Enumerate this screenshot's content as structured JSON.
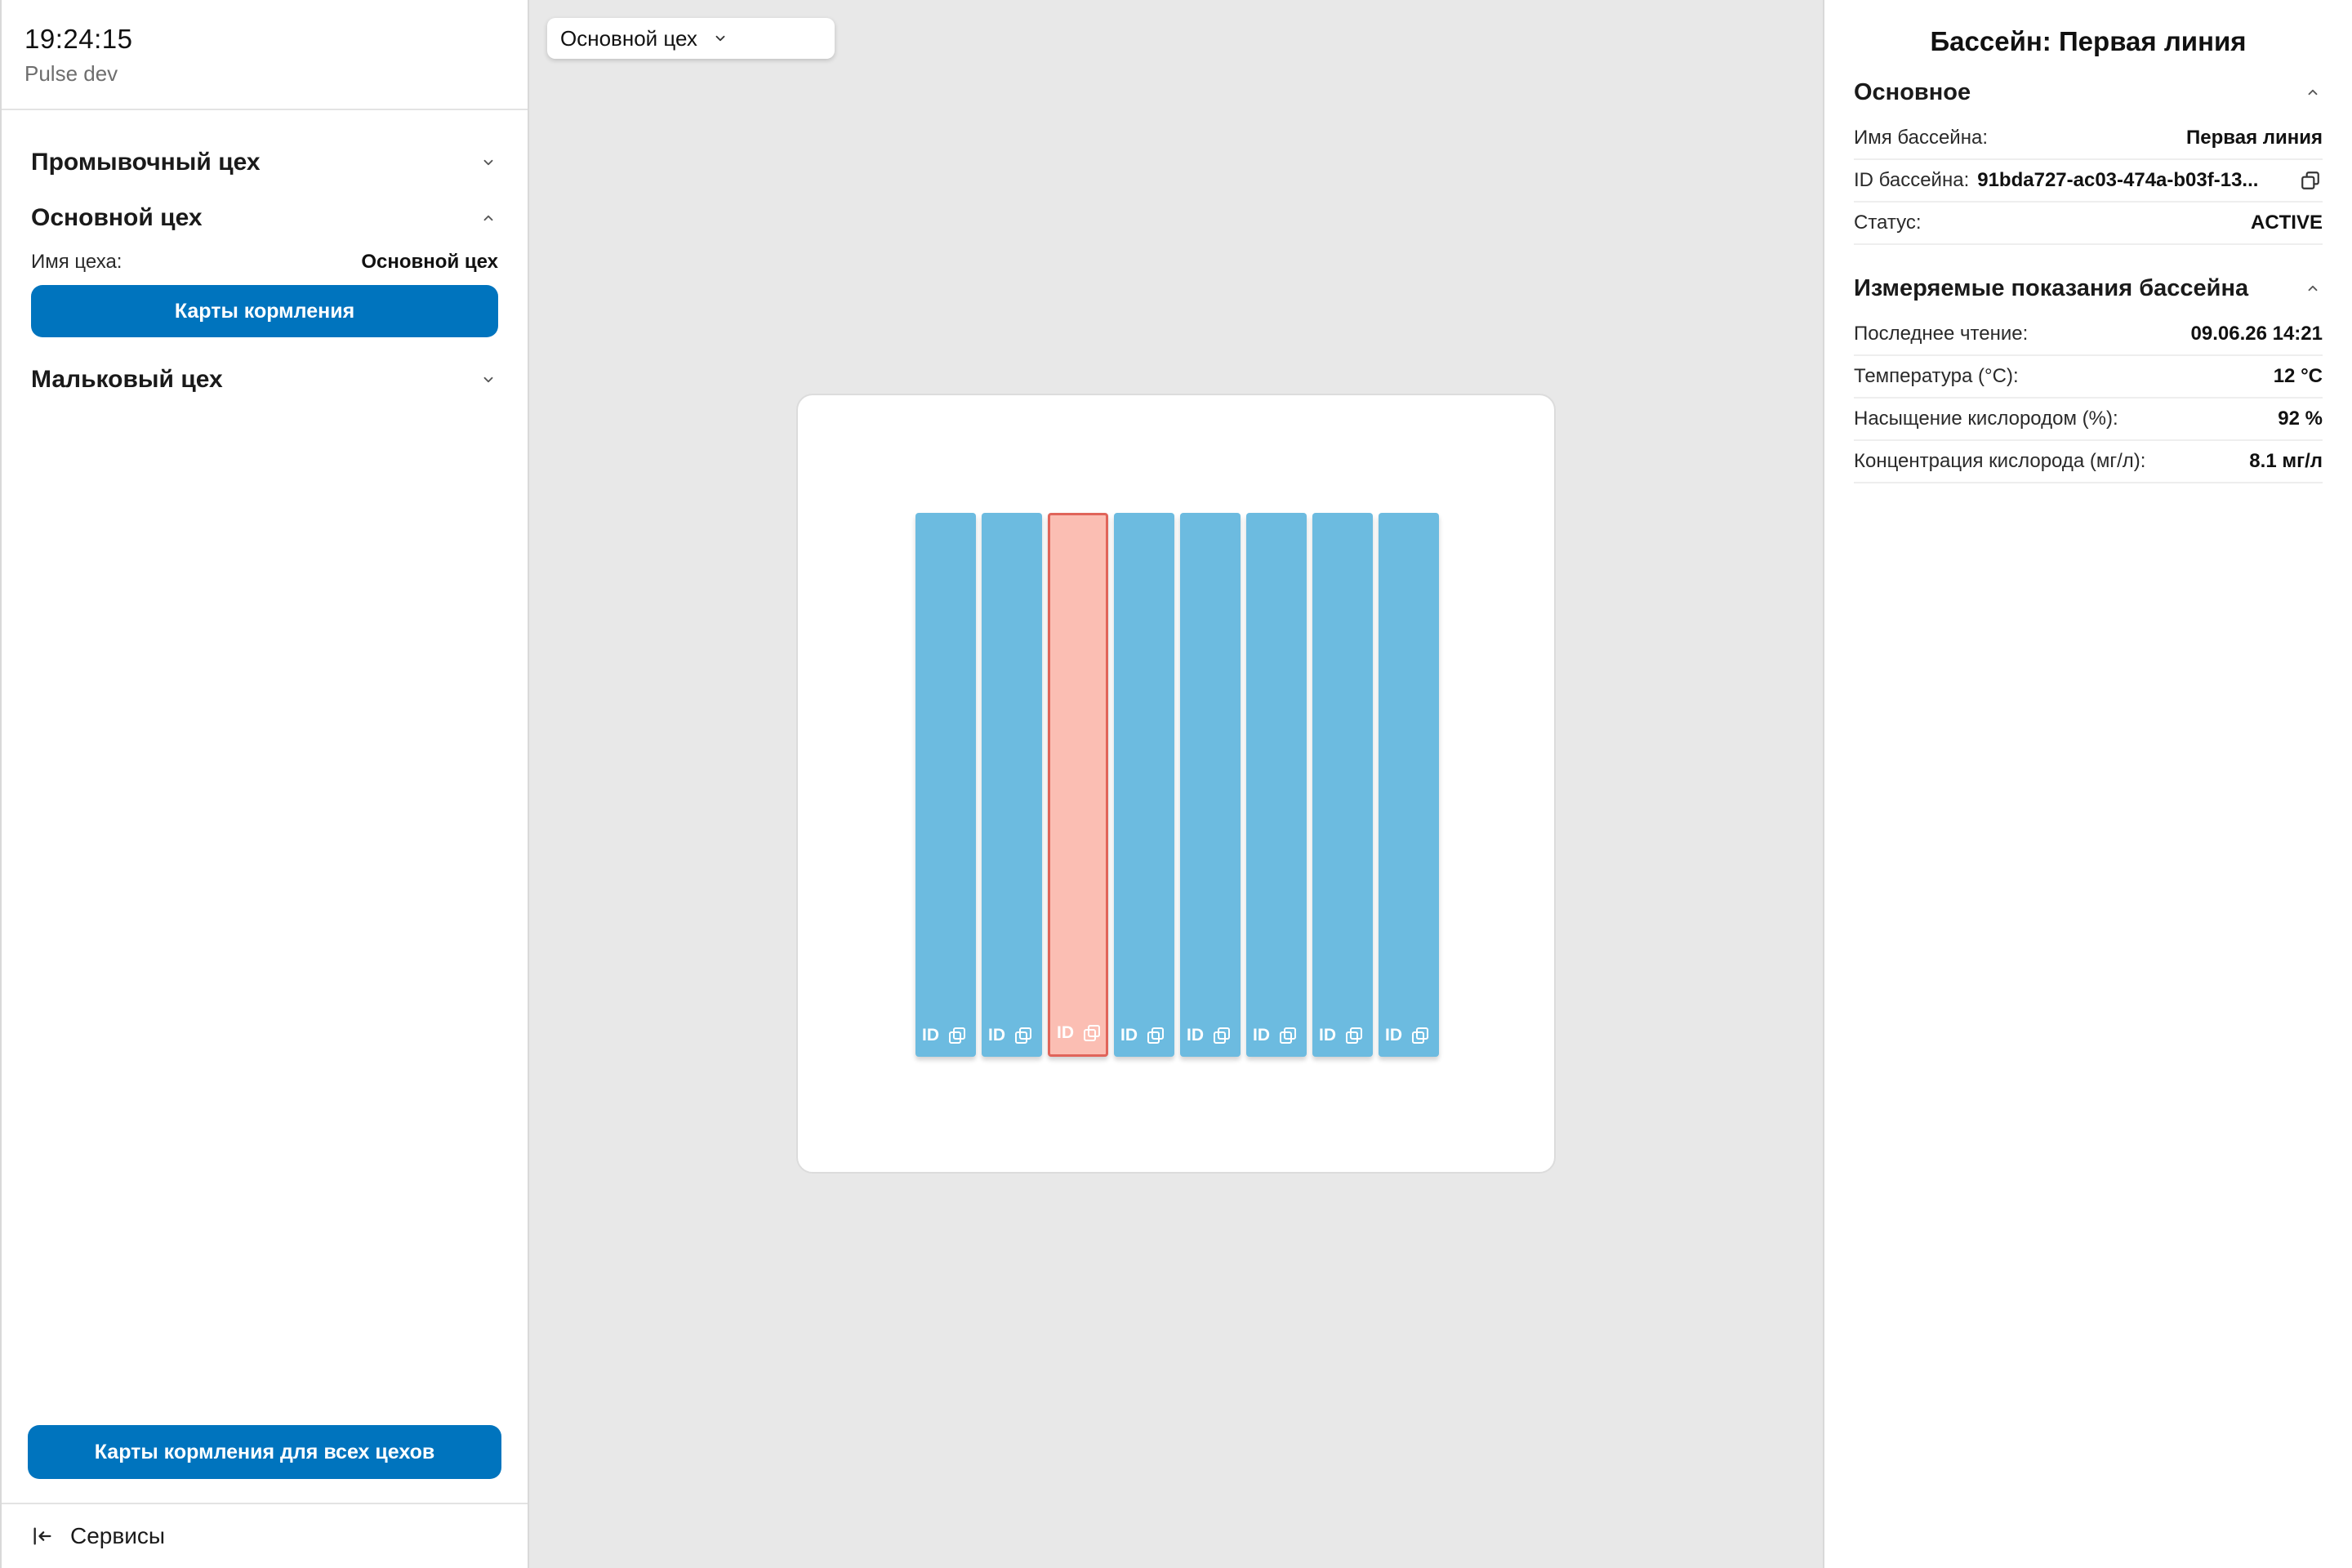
{
  "header": {
    "clock": "19:24:15",
    "environment": "Pulse dev"
  },
  "sidebar": {
    "sections": [
      {
        "title": "Промывочный цех",
        "expanded": false
      },
      {
        "title": "Основной цех",
        "expanded": true,
        "details": {
          "name_label": "Имя цеха:",
          "name_value": "Основной цех",
          "button_label": "Карты кормления"
        }
      },
      {
        "title": "Мальковый цех",
        "expanded": false
      }
    ],
    "all_feed_button": "Карты кормления для всех цехов",
    "footer_label": "Сервисы"
  },
  "canvas": {
    "workshop_selector": "Основной цех",
    "pools": [
      {
        "id_label": "ID",
        "selected": false
      },
      {
        "id_label": "ID",
        "selected": false
      },
      {
        "id_label": "ID",
        "selected": true
      },
      {
        "id_label": "ID",
        "selected": false
      },
      {
        "id_label": "ID",
        "selected": false
      },
      {
        "id_label": "ID",
        "selected": false
      },
      {
        "id_label": "ID",
        "selected": false
      },
      {
        "id_label": "ID",
        "selected": false
      }
    ],
    "colors": {
      "pool": "#6cbbe0",
      "pool_selected_fill": "#fbbeb3",
      "pool_selected_border": "#e0645a"
    }
  },
  "details_panel": {
    "title": "Бассейн: Первая линия",
    "basic": {
      "title": "Основное",
      "rows": [
        {
          "label": "Имя бассейна:",
          "value": "Первая линия"
        },
        {
          "label": "ID бассейна:",
          "value": "91bda727-ac03-474a-b03f-13..."
        },
        {
          "label": "Статус:",
          "value": "ACTIVE"
        }
      ]
    },
    "measurements": {
      "title": "Измеряемые показания бассейна",
      "rows": [
        {
          "label": "Последнее чтение:",
          "value": "09.06.26 14:21"
        },
        {
          "label": "Температура (°C):",
          "value": "12 °C"
        },
        {
          "label": "Насыщение кислородом (%):",
          "value": "92 %"
        },
        {
          "label": "Концентрация кислорода (мг/л):",
          "value": "8.1 мг/л"
        }
      ]
    }
  },
  "theme": {
    "accent": "#0074be"
  }
}
